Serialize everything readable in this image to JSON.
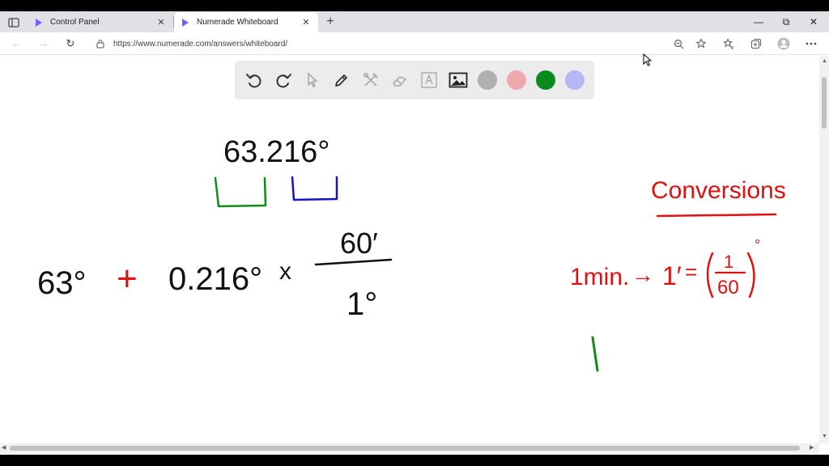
{
  "browser": {
    "tabs": [
      {
        "title": "Control Panel",
        "active": false
      },
      {
        "title": "Numerade Whiteboard",
        "active": true
      }
    ],
    "tab_close_glyph": "✕",
    "new_tab_glyph": "+",
    "window_controls": {
      "minimize": "—",
      "restore": "⧉",
      "close": "✕"
    },
    "url": "https://www.numerade.com/answers/whiteboard/",
    "nav": {
      "back": "←",
      "forward": "→",
      "refresh": "↻"
    },
    "colors": {
      "tab_strip": "#dfe1e5",
      "accent": "#7b5cff"
    }
  },
  "toolbar": {
    "tools": [
      "undo-icon",
      "redo-icon",
      "pointer-icon",
      "pen-icon",
      "tools-icon",
      "eraser-icon",
      "text-icon",
      "image-icon"
    ],
    "swatches": [
      {
        "name": "gray",
        "color": "#b0b0b0"
      },
      {
        "name": "pink",
        "color": "#f0a8b0"
      },
      {
        "name": "green",
        "color": "#0a8a1e"
      },
      {
        "name": "lavender",
        "color": "#b5b8f2"
      }
    ]
  },
  "whiteboard": {
    "top_number": "63.216°",
    "expression": {
      "term1": "63°",
      "plus": "+",
      "term2": "0.216°",
      "times": "x",
      "numerator": "60′",
      "denominator": "1°"
    },
    "conversions": {
      "heading": "Conversions",
      "lhs": "1min.",
      "arrow": "→",
      "prime": "1′",
      "equals": "=",
      "fraction_num": "1",
      "fraction_den": "60",
      "degree": "°"
    },
    "ink_colors": {
      "black": "#111111",
      "red": "#e01010",
      "green": "#138a17",
      "blue": "#1414c8"
    }
  }
}
